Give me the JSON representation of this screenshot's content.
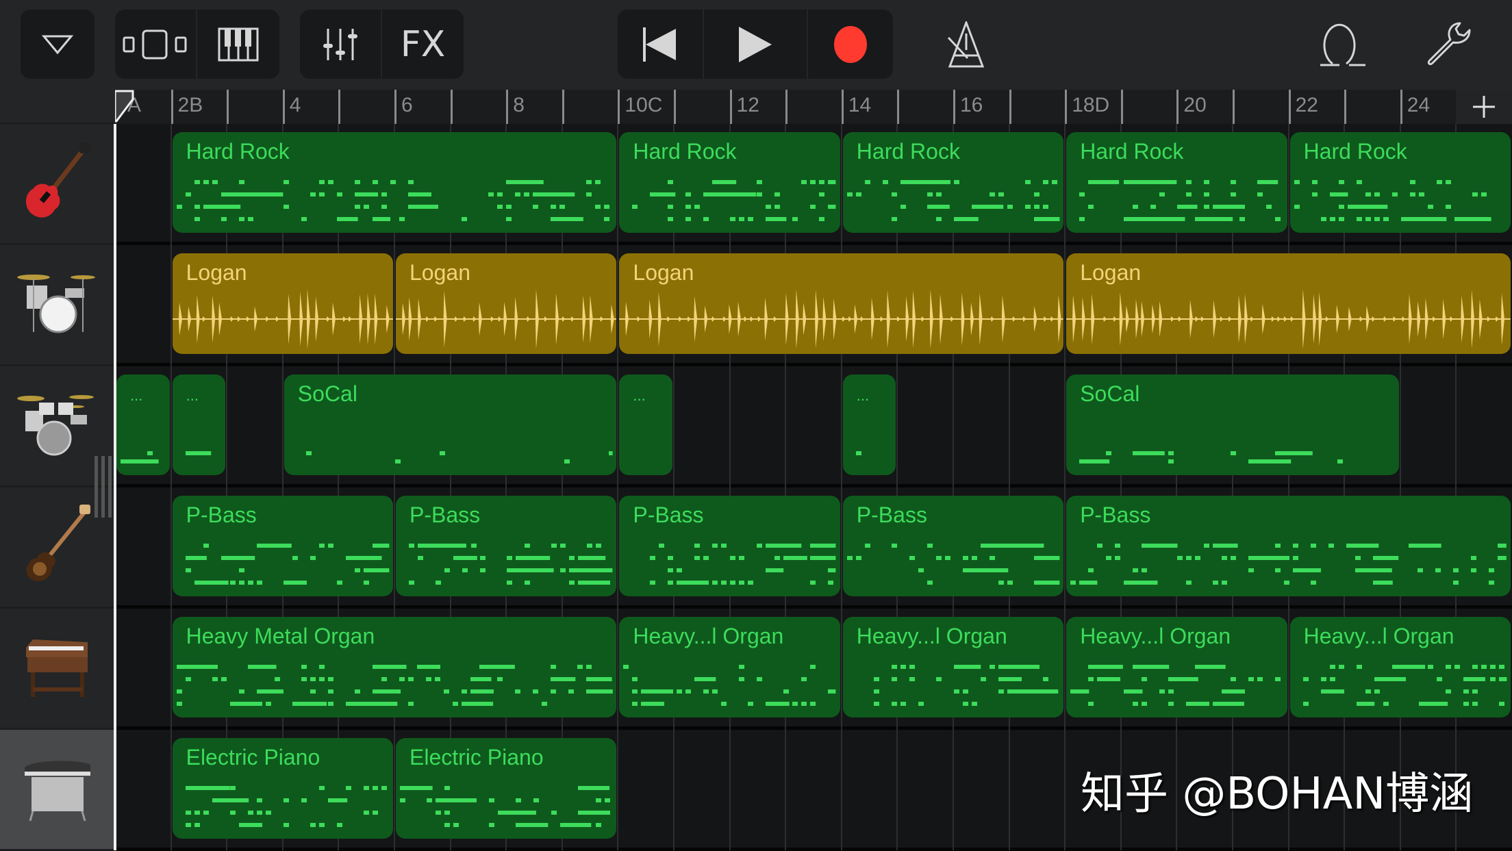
{
  "toolbar": {
    "tracks_dropdown_icon": "triangle-down-icon",
    "view_toggle_icon": "tracks-view-icon",
    "keyboard_icon": "piano-keyboard-icon",
    "mixer_icon": "mixer-sliders-icon",
    "fx_label": "FX",
    "rewind_icon": "skip-to-start-icon",
    "play_icon": "play-icon",
    "record_icon": "record-icon",
    "metronome_icon": "metronome-icon",
    "loop_icon": "loop-browser-icon",
    "settings_icon": "wrench-icon",
    "record_color": "#ff3b30"
  },
  "ruler": {
    "markers": [
      {
        "bar": 1,
        "label": "1A"
      },
      {
        "bar": 2,
        "label": "2B"
      },
      {
        "bar": 3,
        "label": ""
      },
      {
        "bar": 4,
        "label": "4"
      },
      {
        "bar": 5,
        "label": ""
      },
      {
        "bar": 6,
        "label": "6"
      },
      {
        "bar": 7,
        "label": ""
      },
      {
        "bar": 8,
        "label": "8"
      },
      {
        "bar": 9,
        "label": ""
      },
      {
        "bar": 10,
        "label": "10C"
      },
      {
        "bar": 11,
        "label": ""
      },
      {
        "bar": 12,
        "label": "12"
      },
      {
        "bar": 13,
        "label": ""
      },
      {
        "bar": 14,
        "label": "14"
      },
      {
        "bar": 15,
        "label": ""
      },
      {
        "bar": 16,
        "label": "16"
      },
      {
        "bar": 17,
        "label": ""
      },
      {
        "bar": 18,
        "label": "18D"
      },
      {
        "bar": 19,
        "label": ""
      },
      {
        "bar": 20,
        "label": "20"
      },
      {
        "bar": 21,
        "label": ""
      },
      {
        "bar": 22,
        "label": "22"
      },
      {
        "bar": 23,
        "label": ""
      },
      {
        "bar": 24,
        "label": "24"
      }
    ],
    "add_section_label": "+"
  },
  "tracks": [
    {
      "instrument": "electric-guitar-icon",
      "selected": false,
      "regions": [
        {
          "type": "midi",
          "label": "Hard Rock",
          "start": 2,
          "end": 10
        },
        {
          "type": "midi",
          "label": "Hard Rock",
          "start": 10,
          "end": 14
        },
        {
          "type": "midi",
          "label": "Hard Rock",
          "start": 14,
          "end": 18
        },
        {
          "type": "midi",
          "label": "Hard Rock",
          "start": 18,
          "end": 22
        },
        {
          "type": "midi",
          "label": "Hard Rock",
          "start": 22,
          "end": 26
        }
      ]
    },
    {
      "instrument": "drum-kit-icon",
      "selected": false,
      "regions": [
        {
          "type": "audio",
          "label": "Logan",
          "start": 2,
          "end": 6
        },
        {
          "type": "audio",
          "label": "Logan",
          "start": 6,
          "end": 10
        },
        {
          "type": "audio",
          "label": "Logan",
          "start": 10,
          "end": 18
        },
        {
          "type": "audio",
          "label": "Logan",
          "start": 18,
          "end": 26
        }
      ]
    },
    {
      "instrument": "drum-kit-large-icon",
      "selected": false,
      "regions": [
        {
          "type": "midi",
          "label": "...",
          "start": 1,
          "end": 2
        },
        {
          "type": "midi",
          "label": "...",
          "start": 2,
          "end": 3
        },
        {
          "type": "midi",
          "label": "SoCal",
          "start": 4,
          "end": 10
        },
        {
          "type": "midi",
          "label": "...",
          "start": 10,
          "end": 11
        },
        {
          "type": "midi",
          "label": "...",
          "start": 14,
          "end": 15
        },
        {
          "type": "midi",
          "label": "SoCal",
          "start": 18,
          "end": 24
        }
      ]
    },
    {
      "instrument": "bass-guitar-icon",
      "selected": false,
      "regions": [
        {
          "type": "midi",
          "label": "P-Bass",
          "start": 2,
          "end": 6
        },
        {
          "type": "midi",
          "label": "P-Bass",
          "start": 6,
          "end": 10
        },
        {
          "type": "midi",
          "label": "P-Bass",
          "start": 10,
          "end": 14
        },
        {
          "type": "midi",
          "label": "P-Bass",
          "start": 14,
          "end": 18
        },
        {
          "type": "midi",
          "label": "P-Bass",
          "start": 18,
          "end": 26
        }
      ]
    },
    {
      "instrument": "organ-icon",
      "selected": false,
      "regions": [
        {
          "type": "midi",
          "label": "Heavy Metal Organ",
          "start": 2,
          "end": 10
        },
        {
          "type": "midi",
          "label": "Heavy...l Organ",
          "start": 10,
          "end": 14
        },
        {
          "type": "midi",
          "label": "Heavy...l Organ",
          "start": 14,
          "end": 18
        },
        {
          "type": "midi",
          "label": "Heavy...l Organ",
          "start": 18,
          "end": 22
        },
        {
          "type": "midi",
          "label": "Heavy...l Organ",
          "start": 22,
          "end": 26
        }
      ]
    },
    {
      "instrument": "electric-piano-icon",
      "selected": true,
      "regions": [
        {
          "type": "midi",
          "label": "Electric Piano",
          "start": 2,
          "end": 6
        },
        {
          "type": "midi",
          "label": "Electric Piano",
          "start": 6,
          "end": 10
        }
      ]
    }
  ],
  "colors": {
    "midi_region": "#0e5a1d",
    "midi_note": "#3ddc5b",
    "audio_region": "#8b7005",
    "audio_wave": "#f3d37a"
  },
  "watermark": "知乎 @BOHAN博涵"
}
